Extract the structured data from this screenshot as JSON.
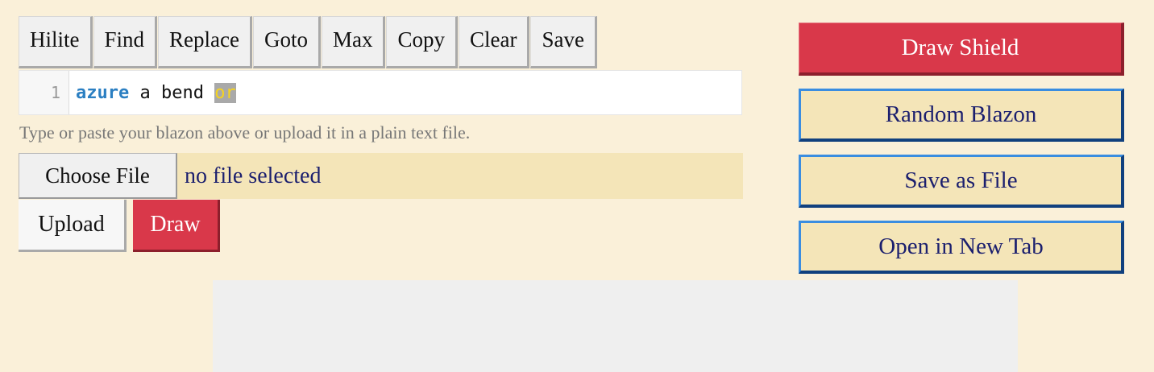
{
  "toolbar": {
    "buttons": [
      "Hilite",
      "Find",
      "Replace",
      "Goto",
      "Max",
      "Copy",
      "Clear",
      "Save"
    ]
  },
  "editor": {
    "line_number": "1",
    "tokens": [
      {
        "text": "azure",
        "kind": "tincture"
      },
      {
        "text": " a bend ",
        "kind": "plain"
      },
      {
        "text": "or",
        "kind": "highlight"
      }
    ]
  },
  "hint": "Type or paste your blazon above or upload it in a plain text file.",
  "file_input": {
    "button_label": "Choose File",
    "status": "no file selected"
  },
  "actions": {
    "upload_label": "Upload",
    "draw_label": "Draw"
  },
  "side_panel": {
    "draw_shield": "Draw Shield",
    "random_blazon": "Random Blazon",
    "save_as_file": "Save as File",
    "open_new_tab": "Open in New Tab"
  },
  "colors": {
    "background": "#faf0d9",
    "accent_red": "#d9384a",
    "accent_blue": "#3a8de0",
    "text_navy": "#1b1f6e"
  }
}
